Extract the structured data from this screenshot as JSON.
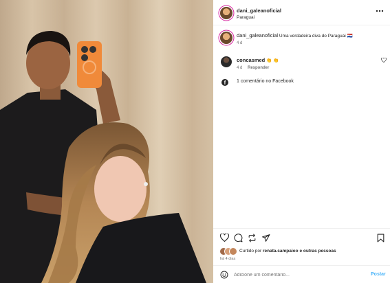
{
  "post": {
    "author": "dani_galeanoficial",
    "location": "Paraguai",
    "more_icon": "more-horizontal-icon"
  },
  "caption": {
    "author": "dani_galeanoficial",
    "text": "Uma verdadeira diva do Paraguai 🇵🇾",
    "time": "4 d"
  },
  "comments": [
    {
      "author": "concasmed",
      "text": "👏 👏",
      "time": "4 d",
      "reply_label": "Responder"
    }
  ],
  "facebook_comments": "1 comentário no Facebook",
  "actions": {
    "like_icon": "heart-icon",
    "comment_icon": "comment-icon",
    "share_icon": "repost-icon",
    "send_icon": "send-icon",
    "save_icon": "bookmark-icon"
  },
  "likes": {
    "prefix": "Curtido por",
    "user": "renata.sampaioo",
    "suffix": "e outras pessoas"
  },
  "posted_ago": "há 4 dias",
  "comment_box": {
    "placeholder": "Adicione um comentário...",
    "post_label": "Postar"
  },
  "colors": {
    "accent_blue": "#4cb5f9",
    "text": "#262626",
    "muted": "#737373",
    "divider": "#efefef"
  }
}
